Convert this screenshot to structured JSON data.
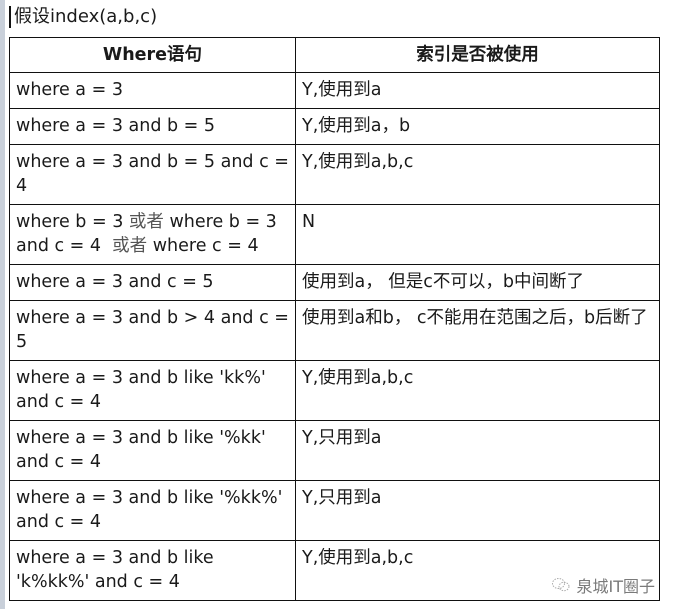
{
  "caption": "假设index(a,b,c)",
  "table": {
    "headers": [
      "Where语句",
      "索引是否被使用"
    ],
    "rows": [
      {
        "where": "where a = 3",
        "used": "Y,使用到a"
      },
      {
        "where": "where a = 3 and b = 5",
        "used": "Y,使用到a，b"
      },
      {
        "where": "where a = 3 and b = 5 and c = 4",
        "used": "Y,使用到a,b,c"
      },
      {
        "where_parts": [
          "where b = 3 ",
          "或者",
          " where b = 3 and c = 4  ",
          "或者",
          " where c = 4"
        ],
        "used": "N"
      },
      {
        "where": "where a = 3 and c = 5",
        "used": "使用到a， 但是c不可以，b中间断了"
      },
      {
        "where": "where a = 3 and b > 4 and c = 5",
        "used": "使用到a和b， c不能用在范围之后，b后断了"
      },
      {
        "where": "where a = 3 and b like 'kk%' and c = 4",
        "used": "Y,使用到a,b,c"
      },
      {
        "where": "where a = 3 and b like '%kk' and c = 4",
        "used": "Y,只用到a"
      },
      {
        "where": "where a = 3 and b like '%kk%' and c = 4",
        "used": "Y,只用到a"
      },
      {
        "where": "where a = 3 and b like 'k%kk%' and c = 4",
        "used": "Y,使用到a,b,c"
      }
    ]
  },
  "watermark": {
    "icon": "wechat-icon",
    "text": "泉城IT圈子"
  }
}
